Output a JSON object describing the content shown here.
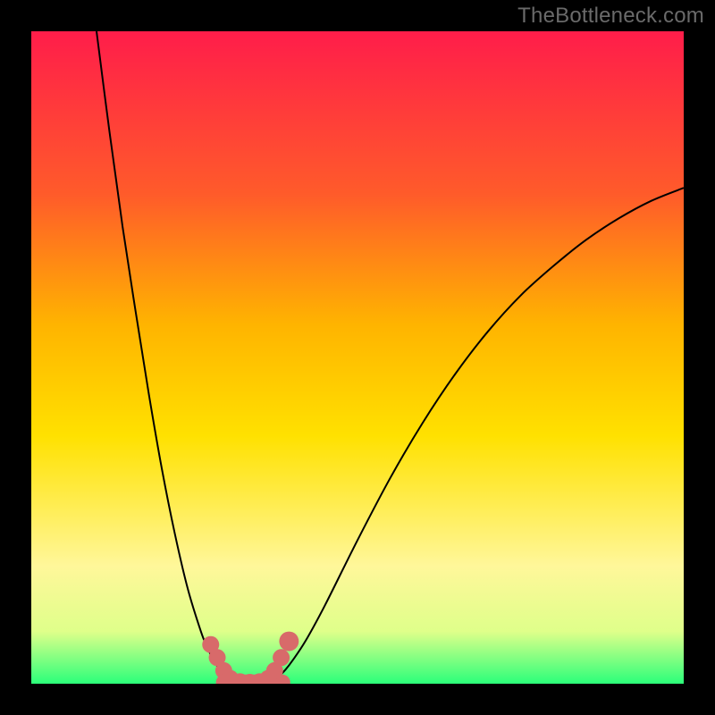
{
  "watermark": "TheBottleneck.com",
  "colors": {
    "frame": "#000000",
    "grad_top": "#ff1d4a",
    "grad_upper": "#ff5b2a",
    "grad_mid_high": "#ffb400",
    "grad_mid": "#ffe100",
    "grad_low": "#fff79a",
    "grad_lower": "#dfff8a",
    "grad_bottom": "#2bff7a",
    "curve": "#000000",
    "marker": "#d86a6a"
  },
  "chart_data": {
    "type": "line",
    "title": "",
    "xlabel": "",
    "ylabel": "",
    "xlim": [
      0,
      100
    ],
    "ylim": [
      0,
      100
    ],
    "series": [
      {
        "name": "curve-left",
        "x": [
          10.0,
          12.0,
          14.0,
          16.0,
          18.0,
          20.0,
          22.0,
          24.0,
          26.0,
          27.0,
          28.0,
          29.0,
          30.0,
          31.0,
          32.0
        ],
        "y": [
          100.0,
          84.5,
          70.0,
          57.0,
          44.5,
          33.0,
          23.0,
          14.5,
          8.0,
          5.5,
          3.5,
          2.0,
          1.0,
          0.5,
          0.2
        ]
      },
      {
        "name": "curve-right",
        "x": [
          36.0,
          37.0,
          38.0,
          39.0,
          40.0,
          42.0,
          45.0,
          50.0,
          55.0,
          60.0,
          65.0,
          70.0,
          75.0,
          80.0,
          85.0,
          90.0,
          95.0,
          100.0
        ],
        "y": [
          0.2,
          0.6,
          1.2,
          2.2,
          3.5,
          6.5,
          12.0,
          22.0,
          31.5,
          40.0,
          47.5,
          54.0,
          59.5,
          64.0,
          68.0,
          71.3,
          74.0,
          76.0
        ]
      }
    ],
    "markers": [
      {
        "x": 27.5,
        "y": 6.0,
        "r": 1.3
      },
      {
        "x": 28.5,
        "y": 4.0,
        "r": 1.3
      },
      {
        "x": 29.5,
        "y": 2.0,
        "r": 1.3
      },
      {
        "x": 30.5,
        "y": 0.8,
        "r": 1.3
      },
      {
        "x": 32.0,
        "y": 0.3,
        "r": 1.3
      },
      {
        "x": 33.5,
        "y": 0.2,
        "r": 1.3
      },
      {
        "x": 35.0,
        "y": 0.3,
        "r": 1.3
      },
      {
        "x": 36.3,
        "y": 0.8,
        "r": 1.3
      },
      {
        "x": 37.3,
        "y": 2.0,
        "r": 1.3
      },
      {
        "x": 38.3,
        "y": 4.0,
        "r": 1.3
      },
      {
        "x": 39.5,
        "y": 6.5,
        "r": 1.5
      }
    ],
    "bottom_band": [
      {
        "x": 29.5,
        "x2": 38.5,
        "r": 1.2
      }
    ]
  }
}
